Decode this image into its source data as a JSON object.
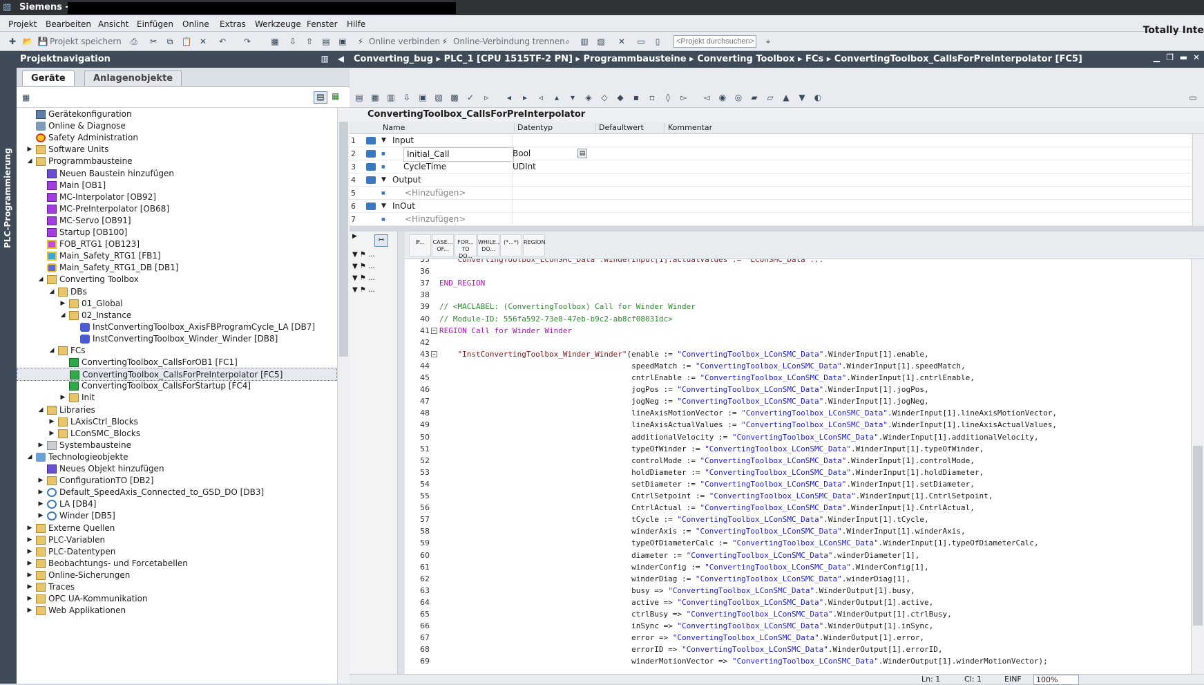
{
  "window": {
    "title": "Siemens - ",
    "brand": "Totally Inte"
  },
  "menu": [
    "Projekt",
    "Bearbeiten",
    "Ansicht",
    "Einfügen",
    "Online",
    "Extras",
    "Werkzeuge",
    "Fenster",
    "Hilfe"
  ],
  "toolbar": {
    "save_label": "Projekt speichern",
    "online_connect": "Online verbinden",
    "online_disconnect": "Online-Verbindung trennen",
    "search_placeholder": "<Projekt durchsuchen>"
  },
  "side_strip_label": "PLC-Programmierung",
  "nav": {
    "title": "Projektnavigation",
    "tabs": [
      "Geräte",
      "Anlagenobjekte"
    ],
    "tree": [
      {
        "label": "Gerätekonfiguration",
        "indent": 2,
        "exp": "",
        "icon": "config-icon"
      },
      {
        "label": "Online & Diagnose",
        "indent": 2,
        "exp": "",
        "icon": "diagnose-icon"
      },
      {
        "label": "Safety Administration",
        "indent": 2,
        "exp": "",
        "icon": "safety-icon"
      },
      {
        "label": "Software Units",
        "indent": 2,
        "exp": "▶",
        "icon": "folder-icon"
      },
      {
        "label": "Programmbausteine",
        "indent": 2,
        "exp": "◢",
        "icon": "folder-icon"
      },
      {
        "label": "Neuen Baustein hinzufügen",
        "indent": 3,
        "exp": "",
        "icon": "add-block-icon"
      },
      {
        "label": "Main [OB1]",
        "indent": 3,
        "exp": "",
        "icon": "ob-icon"
      },
      {
        "label": "MC-Interpolator [OB92]",
        "indent": 3,
        "exp": "",
        "icon": "ob-icon"
      },
      {
        "label": "MC-PreInterpolator [OB68]",
        "indent": 3,
        "exp": "",
        "icon": "ob-icon"
      },
      {
        "label": "MC-Servo [OB91]",
        "indent": 3,
        "exp": "",
        "icon": "ob-icon"
      },
      {
        "label": "Startup [OB100]",
        "indent": 3,
        "exp": "",
        "icon": "ob-icon"
      },
      {
        "label": "FOB_RTG1 [OB123]",
        "indent": 3,
        "exp": "",
        "icon": "ob-safety-icon"
      },
      {
        "label": "Main_Safety_RTG1 [FB1]",
        "indent": 3,
        "exp": "",
        "icon": "fb-safety-icon"
      },
      {
        "label": "Main_Safety_RTG1_DB [DB1]",
        "indent": 3,
        "exp": "",
        "icon": "db-safety-icon"
      },
      {
        "label": "Converting Toolbox",
        "indent": 3,
        "exp": "◢",
        "icon": "folder-icon"
      },
      {
        "label": "DBs",
        "indent": 4,
        "exp": "◢",
        "icon": "folder-icon"
      },
      {
        "label": "01_Global",
        "indent": 5,
        "exp": "▶",
        "icon": "folder-icon"
      },
      {
        "label": "02_Instance",
        "indent": 5,
        "exp": "◢",
        "icon": "folder-icon"
      },
      {
        "label": "InstConvertingToolbox_AxisFBProgramCycle_LA [DB7]",
        "indent": 6,
        "exp": "",
        "icon": "db-icon"
      },
      {
        "label": "InstConvertingToolbox_Winder_Winder [DB8]",
        "indent": 6,
        "exp": "",
        "icon": "db-icon"
      },
      {
        "label": "FCs",
        "indent": 4,
        "exp": "◢",
        "icon": "folder-icon"
      },
      {
        "label": "ConvertingToolbox_CallsForOB1 [FC1]",
        "indent": 5,
        "exp": "",
        "icon": "fc-icon"
      },
      {
        "label": "ConvertingToolbox_CallsForPreInterpolator [FC5]",
        "indent": 5,
        "exp": "",
        "icon": "fc-icon",
        "selected": true
      },
      {
        "label": "ConvertingToolbox_CallsForStartup [FC4]",
        "indent": 5,
        "exp": "",
        "icon": "fc-icon"
      },
      {
        "label": "Init",
        "indent": 5,
        "exp": "▶",
        "icon": "folder-icon"
      },
      {
        "label": "Libraries",
        "indent": 3,
        "exp": "◢",
        "icon": "folder-icon"
      },
      {
        "label": "LAxisCtrl_Blocks",
        "indent": 4,
        "exp": "▶",
        "icon": "folder-icon"
      },
      {
        "label": "LConSMC_Blocks",
        "indent": 4,
        "exp": "▶",
        "icon": "folder-icon"
      },
      {
        "label": "Systembausteine",
        "indent": 3,
        "exp": "▶",
        "icon": "sysfolder-icon"
      },
      {
        "label": "Technologieobjekte",
        "indent": 2,
        "exp": "◢",
        "icon": "techobj-icon"
      },
      {
        "label": "Neues Objekt hinzufügen",
        "indent": 3,
        "exp": "",
        "icon": "add-block-icon"
      },
      {
        "label": "ConfigurationTO [DB2]",
        "indent": 3,
        "exp": "▶",
        "icon": "folder-icon"
      },
      {
        "label": "Default_SpeedAxis_Connected_to_GSD_DO [DB3]",
        "indent": 3,
        "exp": "▶",
        "icon": "axis-icon"
      },
      {
        "label": "LA [DB4]",
        "indent": 3,
        "exp": "▶",
        "icon": "axis-icon"
      },
      {
        "label": "Winder [DB5]",
        "indent": 3,
        "exp": "▶",
        "icon": "axis-icon"
      },
      {
        "label": "Externe Quellen",
        "indent": 2,
        "exp": "▶",
        "icon": "folder-icon"
      },
      {
        "label": "PLC-Variablen",
        "indent": 2,
        "exp": "▶",
        "icon": "folder-icon"
      },
      {
        "label": "PLC-Datentypen",
        "indent": 2,
        "exp": "▶",
        "icon": "folder-icon"
      },
      {
        "label": "Beobachtungs- und Forcetabellen",
        "indent": 2,
        "exp": "▶",
        "icon": "folder-icon"
      },
      {
        "label": "Online-Sicherungen",
        "indent": 2,
        "exp": "▶",
        "icon": "folder-icon"
      },
      {
        "label": "Traces",
        "indent": 2,
        "exp": "▶",
        "icon": "folder-icon"
      },
      {
        "label": "OPC UA-Kommunikation",
        "indent": 2,
        "exp": "▶",
        "icon": "folder-icon"
      },
      {
        "label": "Web Applikationen",
        "indent": 2,
        "exp": "▶",
        "icon": "folder-icon"
      }
    ]
  },
  "breadcrumb": "Converting_bug  ▸  PLC_1 [CPU 1515TF-2 PN]  ▸  Programmbausteine  ▸  Converting Toolbox  ▸  FCs  ▸  ConvertingToolbox_CallsForPreInterpolator [FC5]",
  "block_title": "ConvertingToolbox_CallsForPreInterpolator",
  "interface": {
    "headers": [
      "Name",
      "Datentyp",
      "Defaultwert",
      "Kommentar"
    ],
    "rows": [
      {
        "num": "1",
        "name": "Input",
        "type": "",
        "level": 0,
        "group": true
      },
      {
        "num": "2",
        "name": "Initial_Call",
        "type": "Bool",
        "level": 1,
        "group": false
      },
      {
        "num": "3",
        "name": "CycleTime",
        "type": "UDInt",
        "level": 1,
        "group": false
      },
      {
        "num": "4",
        "name": "Output",
        "type": "",
        "level": 0,
        "group": true
      },
      {
        "num": "5",
        "name": "<Hinzufügen>",
        "type": "",
        "level": 1,
        "group": false,
        "placeholder": true
      },
      {
        "num": "6",
        "name": "InOut",
        "type": "",
        "level": 0,
        "group": true
      },
      {
        "num": "7",
        "name": "<Hinzufügen>",
        "type": "",
        "level": 1,
        "group": false,
        "placeholder": true
      }
    ]
  },
  "snippets": [
    "IF...",
    "CASE... OF...",
    "FOR... TO DO...",
    "WHILE... DO...",
    "(*...*)",
    "REGION"
  ],
  "code": [
    {
      "n": "35",
      "t": "    ConvertingToolbox_LConSMC_Data\".WinderInput[1].actualValues := \"LConSMC_Data\"...",
      "cls": "q"
    },
    {
      "n": "36",
      "t": ""
    },
    {
      "n": "37",
      "t": "END_REGION",
      "cls": "kw"
    },
    {
      "n": "38",
      "t": ""
    },
    {
      "n": "39",
      "t": "// <MACLABEL: (ConvertingToolbox) Call for Winder Winder",
      "cls": "cm"
    },
    {
      "n": "40",
      "t": "// Module-ID: 556fa592-73e8-47eb-b9c2-ab8cf08031dc>",
      "cls": "cm"
    },
    {
      "n": "41",
      "t": "REGION Call for Winder Winder",
      "cls": "kw"
    },
    {
      "n": "42",
      "t": ""
    },
    {
      "n": "43",
      "t": "    \"InstConvertingToolbox_Winder_Winder\"(enable := \"ConvertingToolbox_LConSMC_Data\".WinderInput[1].enable,"
    },
    {
      "n": "44",
      "t": "                                          speedMatch := \"ConvertingToolbox_LConSMC_Data\".WinderInput[1].speedMatch,"
    },
    {
      "n": "45",
      "t": "                                          cntrlEnable := \"ConvertingToolbox_LConSMC_Data\".WinderInput[1].cntrlEnable,"
    },
    {
      "n": "46",
      "t": "                                          jogPos := \"ConvertingToolbox_LConSMC_Data\".WinderInput[1].jogPos,"
    },
    {
      "n": "47",
      "t": "                                          jogNeg := \"ConvertingToolbox_LConSMC_Data\".WinderInput[1].jogNeg,"
    },
    {
      "n": "48",
      "t": "                                          lineAxisMotionVector := \"ConvertingToolbox_LConSMC_Data\".WinderInput[1].lineAxisMotionVector,"
    },
    {
      "n": "49",
      "t": "                                          lineAxisActualValues := \"ConvertingToolbox_LConSMC_Data\".WinderInput[1].lineAxisActualValues,"
    },
    {
      "n": "50",
      "t": "                                          additionalVelocity := \"ConvertingToolbox_LConSMC_Data\".WinderInput[1].additionalVelocity,"
    },
    {
      "n": "51",
      "t": "                                          typeOfWinder := \"ConvertingToolbox_LConSMC_Data\".WinderInput[1].typeOfWinder,"
    },
    {
      "n": "52",
      "t": "                                          controlMode := \"ConvertingToolbox_LConSMC_Data\".WinderInput[1].controlMode,"
    },
    {
      "n": "53",
      "t": "                                          holdDiameter := \"ConvertingToolbox_LConSMC_Data\".WinderInput[1].holdDiameter,"
    },
    {
      "n": "54",
      "t": "                                          setDiameter := \"ConvertingToolbox_LConSMC_Data\".WinderInput[1].setDiameter,"
    },
    {
      "n": "55",
      "t": "                                          CntrlSetpoint := \"ConvertingToolbox_LConSMC_Data\".WinderInput[1].CntrlSetpoint,"
    },
    {
      "n": "56",
      "t": "                                          CntrlActual := \"ConvertingToolbox_LConSMC_Data\".WinderInput[1].CntrlActual,"
    },
    {
      "n": "57",
      "t": "                                          tCycle := \"ConvertingToolbox_LConSMC_Data\".WinderInput[1].tCycle,"
    },
    {
      "n": "58",
      "t": "                                          winderAxis := \"ConvertingToolbox_LConSMC_Data\".WinderInput[1].winderAxis,"
    },
    {
      "n": "59",
      "t": "                                          typeOfDiameterCalc := \"ConvertingToolbox_LConSMC_Data\".WinderInput[1].typeOfDiameterCalc,"
    },
    {
      "n": "60",
      "t": "                                          diameter := \"ConvertingToolbox_LConSMC_Data\".winderDiameter[1],"
    },
    {
      "n": "61",
      "t": "                                          winderConfig := \"ConvertingToolbox_LConSMC_Data\".WinderConfig[1],"
    },
    {
      "n": "62",
      "t": "                                          winderDiag := \"ConvertingToolbox_LConSMC_Data\".winderDiag[1],"
    },
    {
      "n": "63",
      "t": "                                          busy => \"ConvertingToolbox_LConSMC_Data\".WinderOutput[1].busy,"
    },
    {
      "n": "64",
      "t": "                                          active => \"ConvertingToolbox_LConSMC_Data\".WinderOutput[1].active,"
    },
    {
      "n": "65",
      "t": "                                          ctrlBusy => \"ConvertingToolbox_LConSMC_Data\".WinderOutput[1].ctrlBusy,"
    },
    {
      "n": "66",
      "t": "                                          inSync => \"ConvertingToolbox_LConSMC_Data\".WinderOutput[1].inSync,"
    },
    {
      "n": "67",
      "t": "                                          error => \"ConvertingToolbox_LConSMC_Data\".WinderOutput[1].error,"
    },
    {
      "n": "68",
      "t": "                                          errorID => \"ConvertingToolbox_LConSMC_Data\".WinderOutput[1].errorID,"
    },
    {
      "n": "69",
      "t": "                                          winderMotionVector => \"ConvertingToolbox_LConSMC_Data\".WinderOutput[1].winderMotionVector);"
    }
  ],
  "status": {
    "line": "Ln: 1",
    "col": "Cl: 1",
    "mode": "EINF",
    "zoom": "100%"
  }
}
